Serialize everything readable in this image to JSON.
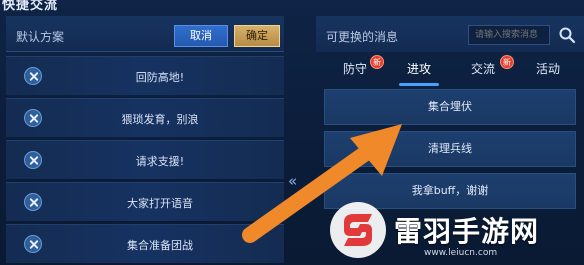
{
  "page_title": "快捷交流",
  "left_panel": {
    "header_label": "默认方案",
    "cancel_label": "取消",
    "confirm_label": "确定",
    "items": [
      {
        "label": "回防高地!"
      },
      {
        "label": "猥琐发育，别浪"
      },
      {
        "label": "请求支援!"
      },
      {
        "label": "大家打开语音"
      },
      {
        "label": "集合准备团战"
      }
    ]
  },
  "divider_icon": "double-chevron-left-icon",
  "right_panel": {
    "header_label": "可更换的消息",
    "search_placeholder": "请输入搜索消息",
    "tabs": [
      {
        "label": "防守",
        "badge": "新",
        "active": false
      },
      {
        "label": "进攻",
        "badge": "",
        "active": true
      },
      {
        "label": "交流",
        "badge": "新",
        "active": false
      },
      {
        "label": "活动",
        "badge": "",
        "active": false
      }
    ],
    "messages": [
      {
        "label": "集合埋伏"
      },
      {
        "label": "清理兵线"
      },
      {
        "label": "我拿buff，谢谢"
      }
    ]
  },
  "watermark": {
    "brand": "雷羽手游网",
    "url": "www.leiucn.com"
  },
  "colors": {
    "accent_blue": "#2f6fd0",
    "accent_gold": "#d6b06a",
    "arrow_orange": "#f0892a",
    "badge_red": "#e6402e"
  }
}
